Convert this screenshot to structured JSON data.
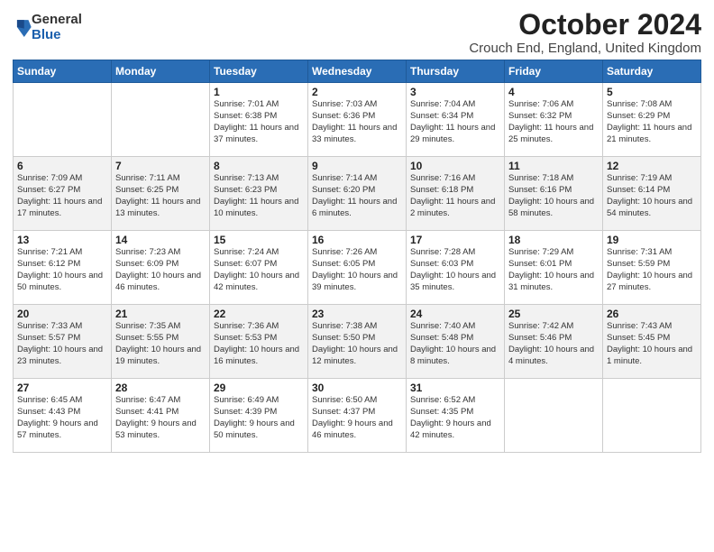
{
  "header": {
    "logo_general": "General",
    "logo_blue": "Blue",
    "month_title": "October 2024",
    "location": "Crouch End, England, United Kingdom"
  },
  "days_of_week": [
    "Sunday",
    "Monday",
    "Tuesday",
    "Wednesday",
    "Thursday",
    "Friday",
    "Saturday"
  ],
  "weeks": [
    [
      {
        "day": "",
        "info": ""
      },
      {
        "day": "",
        "info": ""
      },
      {
        "day": "1",
        "info": "Sunrise: 7:01 AM\nSunset: 6:38 PM\nDaylight: 11 hours\nand 37 minutes."
      },
      {
        "day": "2",
        "info": "Sunrise: 7:03 AM\nSunset: 6:36 PM\nDaylight: 11 hours\nand 33 minutes."
      },
      {
        "day": "3",
        "info": "Sunrise: 7:04 AM\nSunset: 6:34 PM\nDaylight: 11 hours\nand 29 minutes."
      },
      {
        "day": "4",
        "info": "Sunrise: 7:06 AM\nSunset: 6:32 PM\nDaylight: 11 hours\nand 25 minutes."
      },
      {
        "day": "5",
        "info": "Sunrise: 7:08 AM\nSunset: 6:29 PM\nDaylight: 11 hours\nand 21 minutes."
      }
    ],
    [
      {
        "day": "6",
        "info": "Sunrise: 7:09 AM\nSunset: 6:27 PM\nDaylight: 11 hours\nand 17 minutes."
      },
      {
        "day": "7",
        "info": "Sunrise: 7:11 AM\nSunset: 6:25 PM\nDaylight: 11 hours\nand 13 minutes."
      },
      {
        "day": "8",
        "info": "Sunrise: 7:13 AM\nSunset: 6:23 PM\nDaylight: 11 hours\nand 10 minutes."
      },
      {
        "day": "9",
        "info": "Sunrise: 7:14 AM\nSunset: 6:20 PM\nDaylight: 11 hours\nand 6 minutes."
      },
      {
        "day": "10",
        "info": "Sunrise: 7:16 AM\nSunset: 6:18 PM\nDaylight: 11 hours\nand 2 minutes."
      },
      {
        "day": "11",
        "info": "Sunrise: 7:18 AM\nSunset: 6:16 PM\nDaylight: 10 hours\nand 58 minutes."
      },
      {
        "day": "12",
        "info": "Sunrise: 7:19 AM\nSunset: 6:14 PM\nDaylight: 10 hours\nand 54 minutes."
      }
    ],
    [
      {
        "day": "13",
        "info": "Sunrise: 7:21 AM\nSunset: 6:12 PM\nDaylight: 10 hours\nand 50 minutes."
      },
      {
        "day": "14",
        "info": "Sunrise: 7:23 AM\nSunset: 6:09 PM\nDaylight: 10 hours\nand 46 minutes."
      },
      {
        "day": "15",
        "info": "Sunrise: 7:24 AM\nSunset: 6:07 PM\nDaylight: 10 hours\nand 42 minutes."
      },
      {
        "day": "16",
        "info": "Sunrise: 7:26 AM\nSunset: 6:05 PM\nDaylight: 10 hours\nand 39 minutes."
      },
      {
        "day": "17",
        "info": "Sunrise: 7:28 AM\nSunset: 6:03 PM\nDaylight: 10 hours\nand 35 minutes."
      },
      {
        "day": "18",
        "info": "Sunrise: 7:29 AM\nSunset: 6:01 PM\nDaylight: 10 hours\nand 31 minutes."
      },
      {
        "day": "19",
        "info": "Sunrise: 7:31 AM\nSunset: 5:59 PM\nDaylight: 10 hours\nand 27 minutes."
      }
    ],
    [
      {
        "day": "20",
        "info": "Sunrise: 7:33 AM\nSunset: 5:57 PM\nDaylight: 10 hours\nand 23 minutes."
      },
      {
        "day": "21",
        "info": "Sunrise: 7:35 AM\nSunset: 5:55 PM\nDaylight: 10 hours\nand 19 minutes."
      },
      {
        "day": "22",
        "info": "Sunrise: 7:36 AM\nSunset: 5:53 PM\nDaylight: 10 hours\nand 16 minutes."
      },
      {
        "day": "23",
        "info": "Sunrise: 7:38 AM\nSunset: 5:50 PM\nDaylight: 10 hours\nand 12 minutes."
      },
      {
        "day": "24",
        "info": "Sunrise: 7:40 AM\nSunset: 5:48 PM\nDaylight: 10 hours\nand 8 minutes."
      },
      {
        "day": "25",
        "info": "Sunrise: 7:42 AM\nSunset: 5:46 PM\nDaylight: 10 hours\nand 4 minutes."
      },
      {
        "day": "26",
        "info": "Sunrise: 7:43 AM\nSunset: 5:45 PM\nDaylight: 10 hours\nand 1 minute."
      }
    ],
    [
      {
        "day": "27",
        "info": "Sunrise: 6:45 AM\nSunset: 4:43 PM\nDaylight: 9 hours\nand 57 minutes."
      },
      {
        "day": "28",
        "info": "Sunrise: 6:47 AM\nSunset: 4:41 PM\nDaylight: 9 hours\nand 53 minutes."
      },
      {
        "day": "29",
        "info": "Sunrise: 6:49 AM\nSunset: 4:39 PM\nDaylight: 9 hours\nand 50 minutes."
      },
      {
        "day": "30",
        "info": "Sunrise: 6:50 AM\nSunset: 4:37 PM\nDaylight: 9 hours\nand 46 minutes."
      },
      {
        "day": "31",
        "info": "Sunrise: 6:52 AM\nSunset: 4:35 PM\nDaylight: 9 hours\nand 42 minutes."
      },
      {
        "day": "",
        "info": ""
      },
      {
        "day": "",
        "info": ""
      }
    ]
  ]
}
